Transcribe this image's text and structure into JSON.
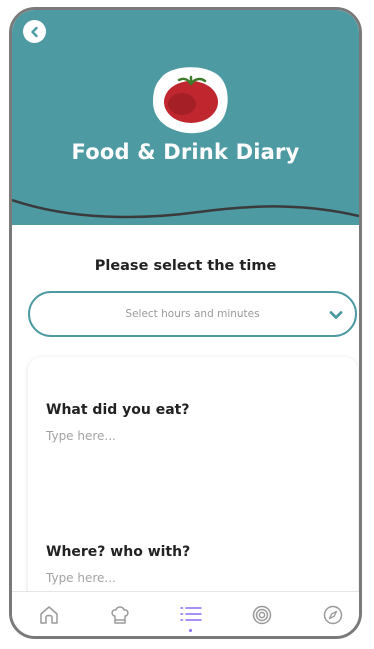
{
  "header": {
    "title": "Food & Drink Diary",
    "background_color": "#4e9aa3",
    "back_icon": "chevron-left-icon",
    "logo_icon": "tomato-icon"
  },
  "time": {
    "prompt": "Please select the time",
    "select_placeholder": "Select hours and minutes",
    "accent_color": "#4e9aa3"
  },
  "form": {
    "questions": [
      {
        "label": "What did you eat?",
        "placeholder": "Type here..."
      },
      {
        "label": "Where? who with?",
        "placeholder": "Type here..."
      }
    ]
  },
  "tabbar": {
    "active_color": "#8a6ff0",
    "items": [
      {
        "icon": "home-icon",
        "active": false
      },
      {
        "icon": "chef-hat-icon",
        "active": false
      },
      {
        "icon": "list-icon",
        "active": true
      },
      {
        "icon": "target-icon",
        "active": false
      },
      {
        "icon": "compass-icon",
        "active": false
      }
    ]
  }
}
